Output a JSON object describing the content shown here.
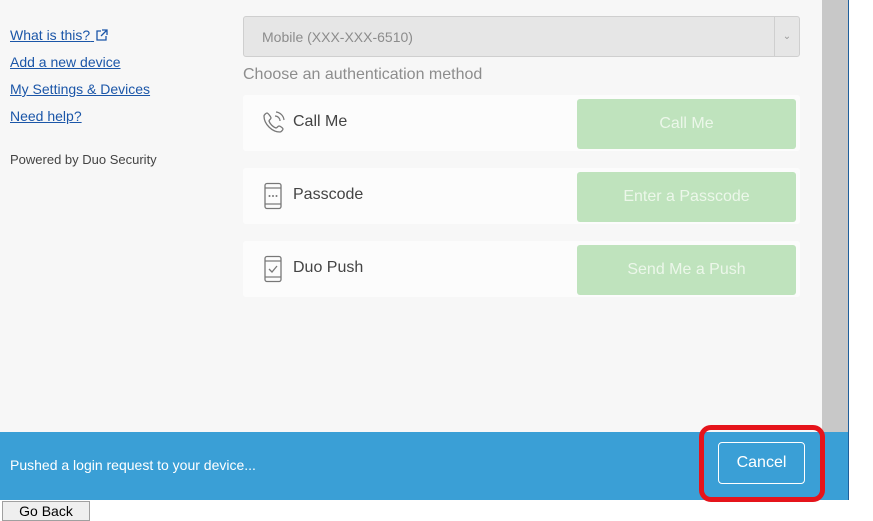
{
  "sidebar": {
    "links": [
      {
        "label": "What is this?"
      },
      {
        "label": "Add a new device"
      },
      {
        "label": "My Settings & Devices"
      },
      {
        "label": "Need help?"
      }
    ],
    "powered_by": "Powered by Duo Security"
  },
  "device_select": {
    "value": "Mobile (XXX-XXX-6510)"
  },
  "methods": {
    "heading": "Choose an authentication method",
    "items": [
      {
        "name": "Call Me",
        "icon": "phone-icon",
        "button": "Call Me"
      },
      {
        "name": "Passcode",
        "icon": "passcode-device-icon",
        "button": "Enter a Passcode"
      },
      {
        "name": "Duo Push",
        "icon": "push-device-icon",
        "button": "Send Me a Push"
      }
    ]
  },
  "status": {
    "message": "Pushed a login request to your device...",
    "cancel": "Cancel"
  },
  "browser": {
    "go_back": "Go Back"
  },
  "colors": {
    "status_bar": "#3a9fd6",
    "highlight": "#e5141b",
    "disabled_button": "#bfe3bd"
  }
}
